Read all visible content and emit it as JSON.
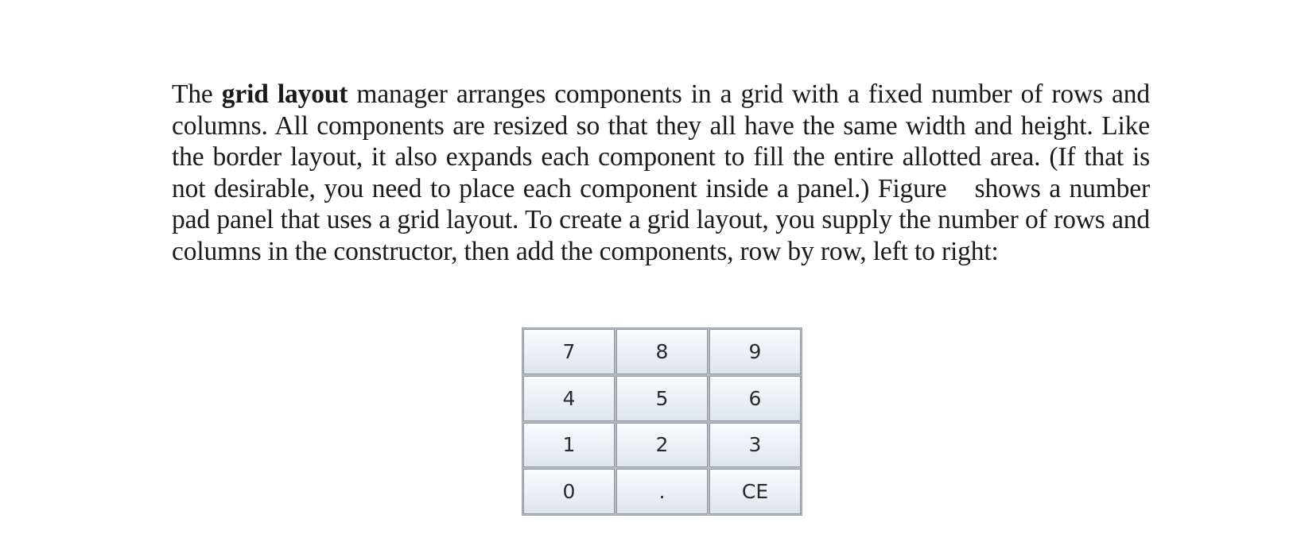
{
  "paragraph": {
    "intro": "The ",
    "term": "grid layout",
    "part1": " manager arranges components in a grid with a fixed number of rows and columns. All components are resized so that they all have the same width and height. Like the border layout, it also expands each component to fill the entire allotted area. (If that is not desirable, you need to place each component inside a panel.) Figure",
    "part2": "shows a number pad panel that uses a grid layout. To create a grid layout, you supply the number of rows and columns in the constructor, then add the components, row by row, left to right:"
  },
  "keypad": {
    "keys": [
      "7",
      "8",
      "9",
      "4",
      "5",
      "6",
      "1",
      "2",
      "3",
      "0",
      ".",
      "CE"
    ]
  }
}
